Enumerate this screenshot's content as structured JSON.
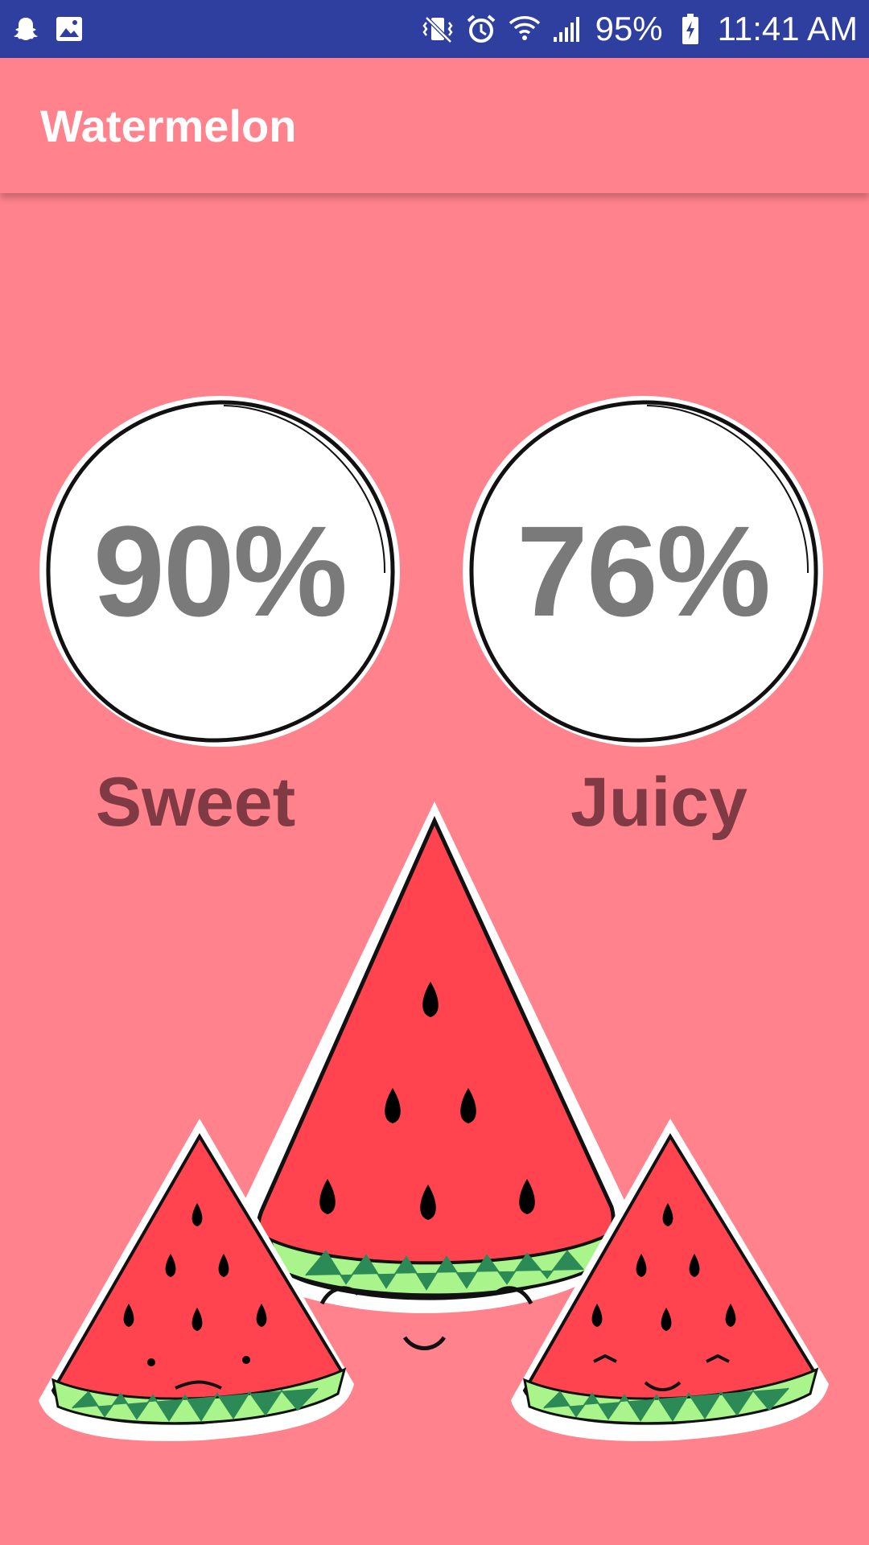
{
  "status_bar": {
    "battery_percent": "95%",
    "time": "11:41 AM",
    "left_icons": [
      "snapchat-icon",
      "image-icon"
    ],
    "right_icons": [
      "vibrate-icon",
      "alarm-icon",
      "wifi-icon",
      "signal-icon",
      "battery-charging-icon"
    ]
  },
  "app_bar": {
    "title": "Watermelon"
  },
  "stats": [
    {
      "value": "90%",
      "label": "Sweet",
      "percent": 90
    },
    {
      "value": "76%",
      "label": "Juicy",
      "percent": 76
    }
  ],
  "illustration": {
    "name": "three watermelon slices",
    "colors": {
      "flesh": "#ff4450",
      "rind_light": "#a9f58c",
      "rind_dark": "#2b8a56",
      "seed": "#000000"
    }
  },
  "theme": {
    "background": "#ff828c",
    "status_bar": "#2f3f9f",
    "value_text": "#7a7a7a",
    "label_text": "#7f3a44"
  }
}
